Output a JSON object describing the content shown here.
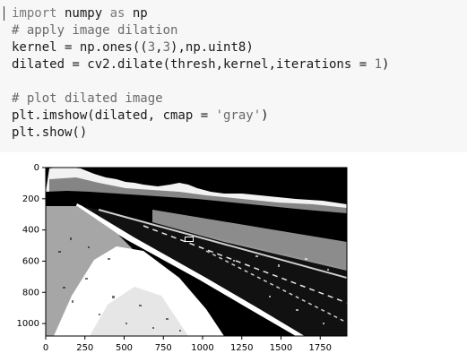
{
  "code_cell": {
    "lines": [
      {
        "parts": [
          {
            "t": "import",
            "c": "kw"
          },
          {
            "t": " numpy ",
            "c": ""
          },
          {
            "t": "as",
            "c": "kw"
          },
          {
            "t": " np",
            "c": ""
          }
        ]
      },
      {
        "parts": [
          {
            "t": "# apply image dilation",
            "c": "cm"
          }
        ]
      },
      {
        "parts": [
          {
            "t": "kernel = np.ones((",
            "c": ""
          },
          {
            "t": "3",
            "c": "num"
          },
          {
            "t": ",",
            "c": ""
          },
          {
            "t": "3",
            "c": "num"
          },
          {
            "t": "),np.uint8)",
            "c": ""
          }
        ]
      },
      {
        "parts": [
          {
            "t": "dilated = cv2.dilate(thresh,kernel,iterations = ",
            "c": ""
          },
          {
            "t": "1",
            "c": "num"
          },
          {
            "t": ")",
            "c": ""
          }
        ]
      },
      {
        "parts": [
          {
            "t": "",
            "c": ""
          }
        ]
      },
      {
        "parts": [
          {
            "t": "# plot dilated image",
            "c": "cm"
          }
        ]
      },
      {
        "parts": [
          {
            "t": "plt.imshow(dilated, cmap = ",
            "c": ""
          },
          {
            "t": "'gray'",
            "c": "str"
          },
          {
            "t": ")",
            "c": ""
          }
        ]
      },
      {
        "parts": [
          {
            "t": "plt.show()",
            "c": ""
          }
        ]
      }
    ]
  },
  "plot": {
    "x_ticks": [
      "0",
      "250",
      "500",
      "750",
      "1000",
      "1250",
      "1500",
      "1750"
    ],
    "y_ticks": [
      "0",
      "200",
      "400",
      "600",
      "800",
      "1000"
    ],
    "image_description_name": "dilated-road-image"
  }
}
